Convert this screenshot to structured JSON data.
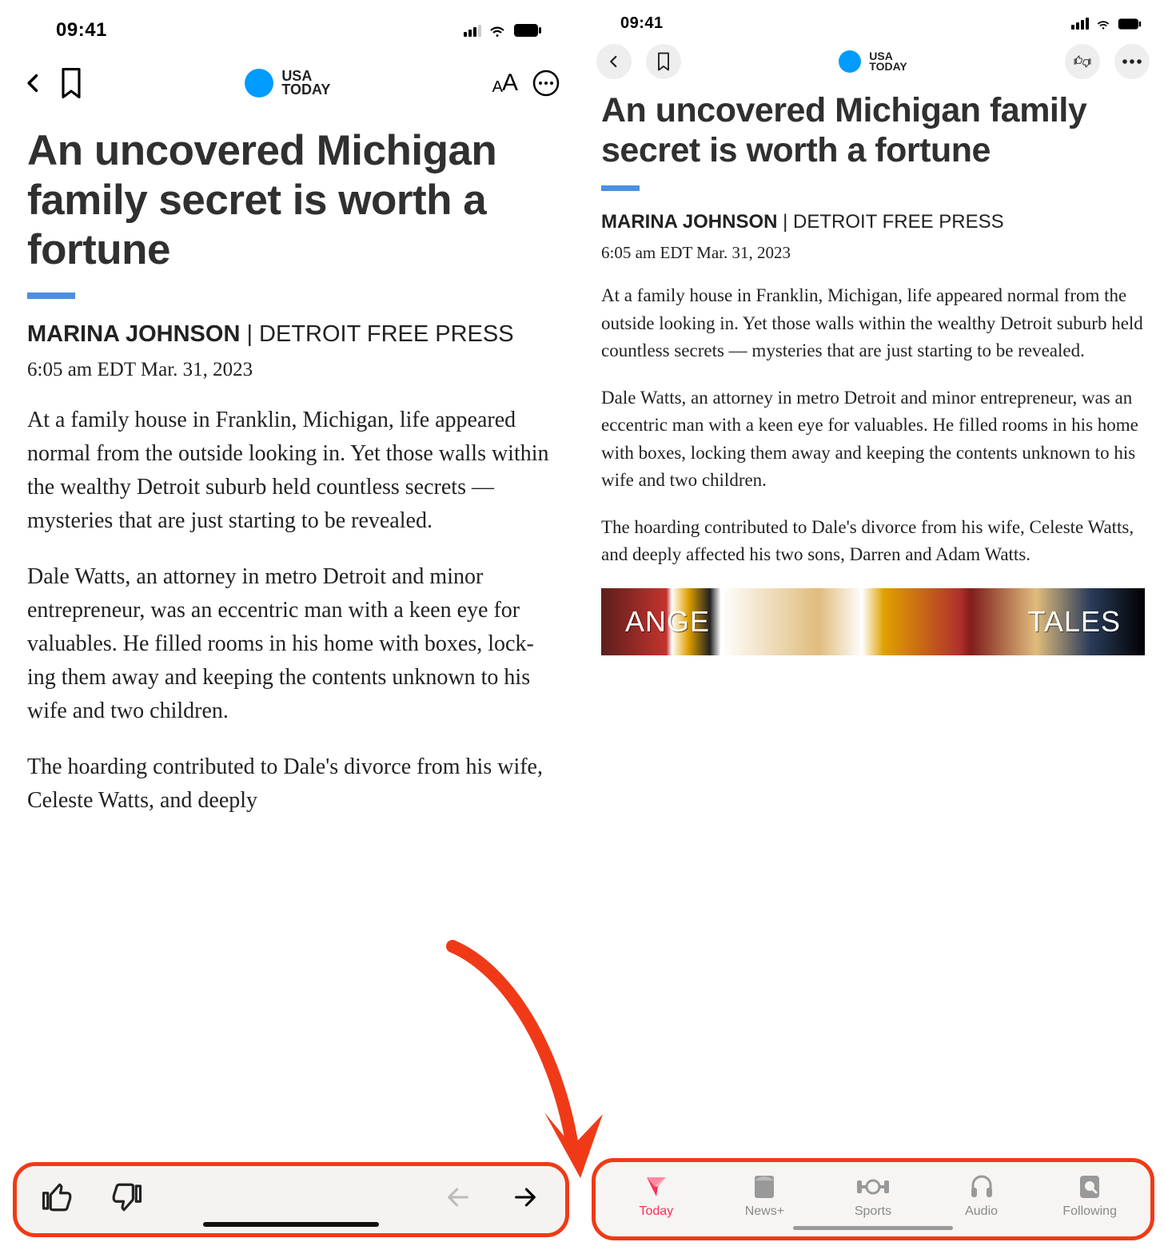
{
  "status": {
    "time": "09:41"
  },
  "brand": {
    "line1": "USA",
    "line2": "TODAY"
  },
  "article": {
    "headline": "An uncovered Michigan family secret is worth a fortune",
    "author": "MARINA JOHNSON",
    "byline_sep": " | ",
    "publication": "DETROIT FREE PRESS",
    "timestamp": "6:05 am EDT Mar. 31, 2023",
    "p1": "At a family house in Franklin, Michigan, life appeared normal from the outside looking in. Yet those walls within the wealthy Detroit suburb held countless se­crets — mysteries that are just starting to be revealed.",
    "p1b": "At a family house in Franklin, Michigan, life appeared normal from the outside looking in. Yet those walls within the wealthy Detroit suburb held countless secrets — mysteries that are just starting to be revealed.",
    "p2": "Dale Watts, an attorney in metro Detroit and minor entrepreneur, was an eccentric man with a keen eye for valuables. He filled rooms in his home with boxes, lock­ing them away and keeping the contents unknown to his wife and two children.",
    "p2b": "Dale Watts, an attorney in metro Detroit and minor entrepreneur, was an eccentric man with a keen eye for valuables. He filled rooms in his home with boxes, locking them away and keeping the contents unknown to his wife and two children.",
    "p3_left": "The hoarding contributed to Dale's divorce from his wife, Celeste Watts, and deeply",
    "p3_right": "The hoarding contributed to Dale's divorce from his wife, Celeste Watts, and deeply af­fected his two sons, Darren and Adam Watts."
  },
  "strip": {
    "left_word": "ANGE",
    "right_word": "TALES"
  },
  "tabs": {
    "today": "Today",
    "newsplus": "News+",
    "sports": "Sports",
    "audio": "Audio",
    "following": "Following"
  }
}
